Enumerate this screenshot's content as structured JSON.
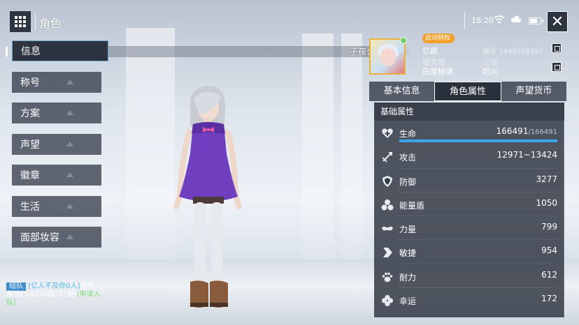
{
  "header": {
    "title": "角色",
    "time": "18:20"
  },
  "nav": {
    "items": [
      {
        "label": "信息",
        "active": true
      },
      {
        "label": "称号"
      },
      {
        "label": "方案"
      },
      {
        "label": "声望"
      },
      {
        "label": "徽章"
      },
      {
        "label": "生活"
      },
      {
        "label": "面部妆容"
      }
    ]
  },
  "profile": {
    "guild_title": "子夜会精英损失",
    "privilege_badge": "启动特权",
    "name": "忆卿",
    "uid_label": "编号",
    "uid_value": "1449928497",
    "server_label": "服务器",
    "server_value": "白雪秘境",
    "guild_label": "公会",
    "guild_value": "炽火"
  },
  "tabs": [
    {
      "label": "基本信息"
    },
    {
      "label": "角色属性",
      "active": true
    },
    {
      "label": "声望货币"
    }
  ],
  "stats": {
    "section_title": "基础属性",
    "hp": {
      "label": "生命",
      "value": "166491",
      "max": "/166491",
      "fill": 1.0
    },
    "rows": [
      {
        "label": "攻击",
        "value": "12971~13424",
        "icon": "sword-icon"
      },
      {
        "label": "防御",
        "value": "3277",
        "icon": "shield-icon"
      },
      {
        "label": "能量盾",
        "value": "1050",
        "icon": "energy-shield-icon"
      },
      {
        "label": "力量",
        "value": "799",
        "icon": "strength-icon"
      },
      {
        "label": "敏捷",
        "value": "954",
        "icon": "agility-icon"
      },
      {
        "label": "耐力",
        "value": "612",
        "icon": "paw-icon"
      },
      {
        "label": "幸运",
        "value": "172",
        "icon": "clover-icon"
      }
    ]
  },
  "chat": {
    "channel": "组队",
    "name": "[亿人不及你0人]",
    "world": "世界",
    "line2": "首领(3/4)[40级-72级]",
    "recruit": "[申请入",
    "line3": "队]"
  },
  "colors": {
    "accent_blue": "#3aa7e6",
    "privilege_orange": "#f2a02a",
    "panel_dark": "#343a46"
  }
}
